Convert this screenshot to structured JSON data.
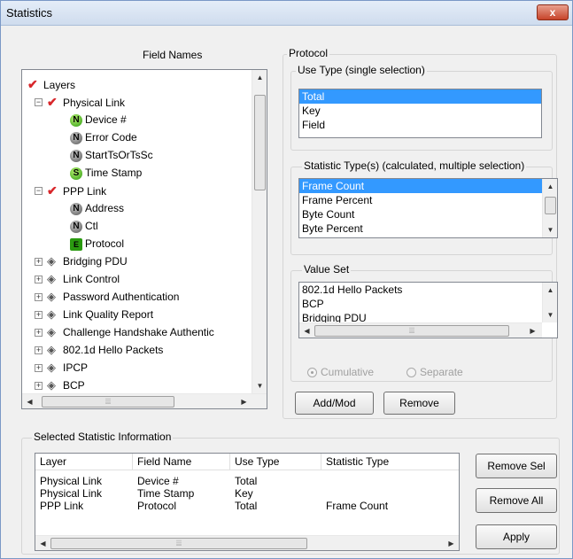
{
  "window": {
    "title": "Statistics",
    "close_label": "x"
  },
  "field_names": {
    "label": "Field Names",
    "tree": [
      {
        "label": "Layers",
        "icon": "check-icon",
        "level": 0,
        "expander": ""
      },
      {
        "label": "Physical Link",
        "icon": "check-icon",
        "level": 1,
        "expander": "-"
      },
      {
        "label": "Device #",
        "icon": "n",
        "level": 2,
        "expander": ""
      },
      {
        "label": "Error Code",
        "icon": "n-gray",
        "level": 2,
        "expander": ""
      },
      {
        "label": "StartTsOrTsSc",
        "icon": "n-gray",
        "level": 2,
        "expander": ""
      },
      {
        "label": "Time Stamp",
        "icon": "s",
        "level": 2,
        "expander": ""
      },
      {
        "label": "PPP Link",
        "icon": "check-icon",
        "level": 1,
        "expander": "-"
      },
      {
        "label": "Address",
        "icon": "n-gray",
        "level": 2,
        "expander": ""
      },
      {
        "label": "Ctl",
        "icon": "n-gray",
        "level": 2,
        "expander": ""
      },
      {
        "label": "Protocol",
        "icon": "e",
        "level": 2,
        "expander": ""
      },
      {
        "label": "Bridging PDU",
        "icon": "layer-icon",
        "level": 1,
        "expander": "+"
      },
      {
        "label": "Link Control",
        "icon": "layer-icon",
        "level": 1,
        "expander": "+"
      },
      {
        "label": "Password Authentication",
        "icon": "layer-icon",
        "level": 1,
        "expander": "+"
      },
      {
        "label": "Link Quality Report",
        "icon": "layer-icon",
        "level": 1,
        "expander": "+"
      },
      {
        "label": "Challenge Handshake Authentic",
        "icon": "layer-icon",
        "level": 1,
        "expander": "+"
      },
      {
        "label": "802.1d Hello Packets",
        "icon": "layer-icon",
        "level": 1,
        "expander": "+"
      },
      {
        "label": "IPCP",
        "icon": "layer-icon",
        "level": 1,
        "expander": "+"
      },
      {
        "label": "BCP",
        "icon": "layer-icon",
        "level": 1,
        "expander": "+"
      }
    ]
  },
  "protocol": {
    "label": "Protocol",
    "use_type": {
      "label": "Use Type (single selection)",
      "options": [
        "Total",
        "Key",
        "Field"
      ],
      "selected": "Total"
    },
    "statistic_types": {
      "label": "Statistic Type(s) (calculated, multiple selection)",
      "options": [
        "Frame Count",
        "Frame Percent",
        "Byte Count",
        "Byte Percent"
      ],
      "selected": "Frame Count"
    },
    "value_set": {
      "label": "Value Set",
      "options": [
        "802.1d Hello Packets",
        "BCP",
        "Bridging PDU"
      ]
    },
    "radio_cumulative": "Cumulative",
    "radio_separate": "Separate",
    "add_mod_label": "Add/Mod",
    "remove_label": "Remove"
  },
  "selected_stats": {
    "label": "Selected Statistic Information",
    "columns": [
      "Layer",
      "Field Name",
      "Use Type",
      "Statistic Type"
    ],
    "rows": [
      [
        "Physical Link",
        "Device #",
        "Total",
        ""
      ],
      [
        "Physical Link",
        "Time Stamp",
        "Key",
        ""
      ],
      [
        "PPP Link",
        "Protocol",
        "Total",
        "Frame Count"
      ]
    ],
    "remove_sel_label": "Remove Sel",
    "remove_all_label": "Remove All",
    "apply_label": "Apply"
  },
  "colors": {
    "selection": "#3399ff",
    "check": "#d8262a"
  }
}
